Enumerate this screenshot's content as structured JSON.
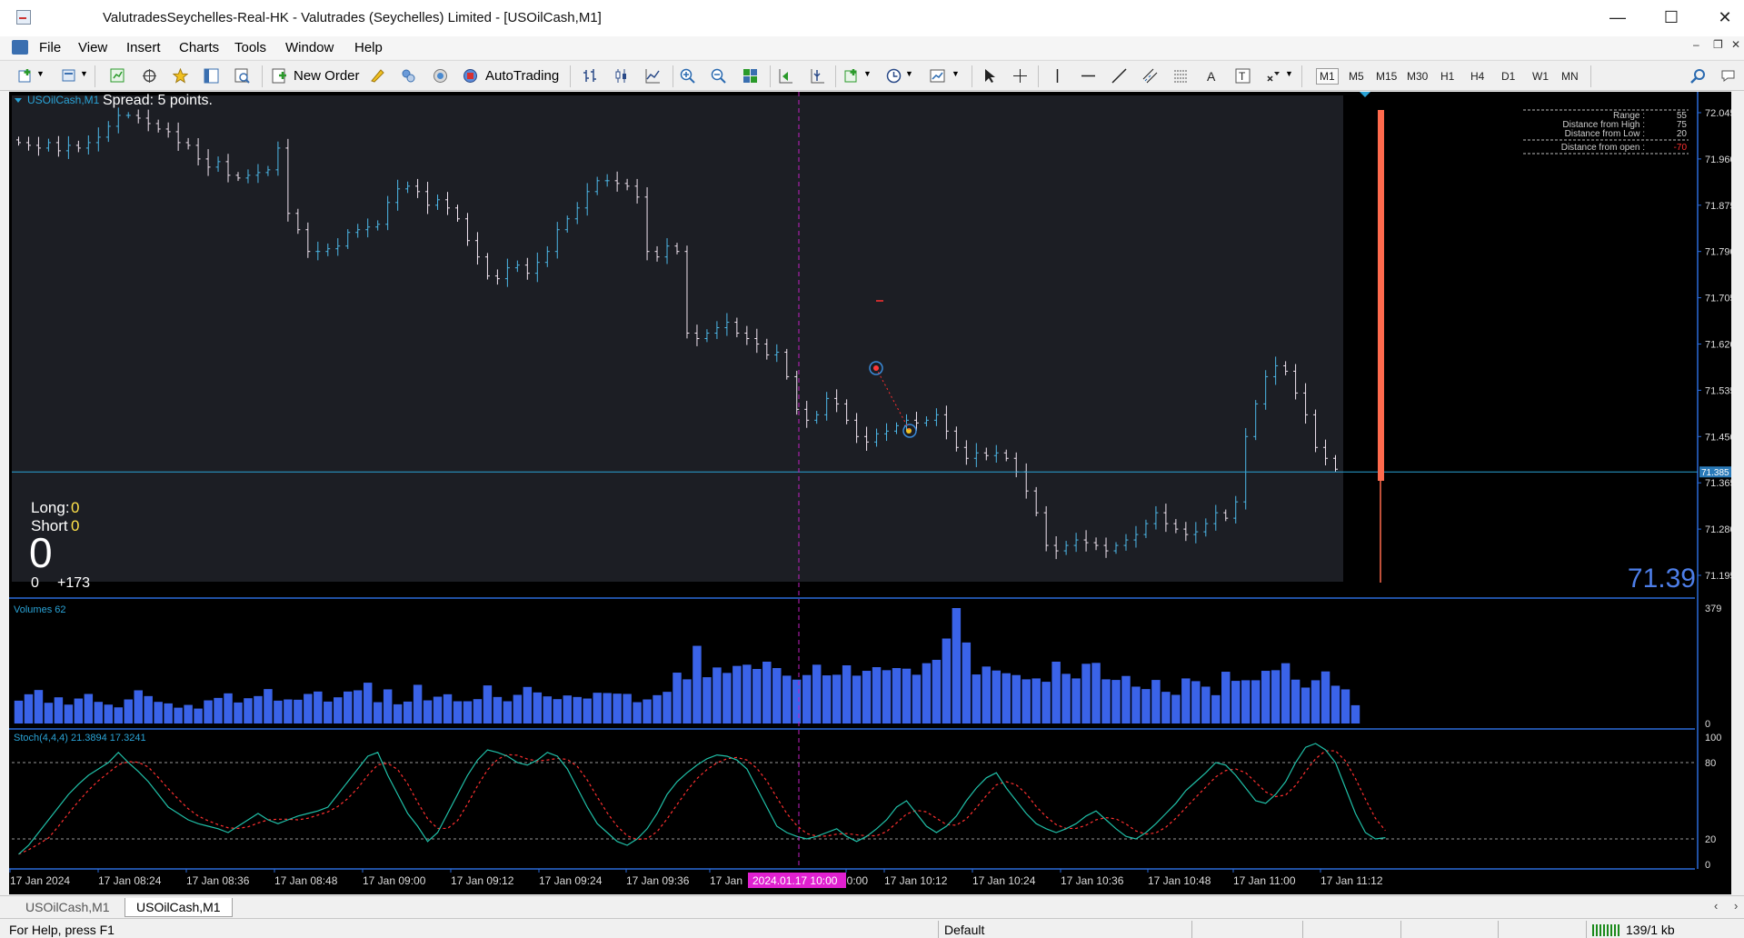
{
  "window": {
    "title": "ValutradesSeychelles-Real-HK - Valutrades (Seychelles) Limited - [USOilCash,M1]",
    "minimize_icon": "minimize-icon",
    "maximize_icon": "maximize-icon",
    "close_icon": "close-icon"
  },
  "menu": {
    "items": [
      "File",
      "View",
      "Insert",
      "Charts",
      "Tools",
      "Window",
      "Help"
    ]
  },
  "toolbar": {
    "new_order_label": "New Order",
    "autotrading_label": "AutoTrading",
    "timeframes": [
      "M1",
      "M5",
      "M15",
      "M30",
      "H1",
      "H4",
      "D1",
      "W1",
      "MN"
    ],
    "active_timeframe": "M1"
  },
  "chart": {
    "symbol_label": "USOilCash,M1",
    "spread_text": "Spread: 5 points.",
    "long_label": "Long:",
    "long_value": "0",
    "short_label": "Short",
    "short_value": "0",
    "big_value": "0",
    "bottom_left_a": "0",
    "bottom_left_b": "+173",
    "current_price_tag": "71.385",
    "current_price_big": "71.39",
    "info_panel": [
      {
        "label": "Range :",
        "value": "55"
      },
      {
        "label": "Distance from High :",
        "value": "75"
      },
      {
        "label": "Distance from Low :",
        "value": "20"
      },
      {
        "label": "Distance from open :",
        "value": "-70"
      }
    ],
    "colors": {
      "background": "#000000",
      "plot_bg": "#1c1e24",
      "bull_candle": "#4db8e8",
      "bear_candle": "#f1e4f0",
      "price_line": "#2aa3d6",
      "price_tag": "#2a7ab8",
      "big_price": "#4d7ee8",
      "red_bar": "#ff6a4d",
      "vline": "#c020c0",
      "volume": "#3a63e8",
      "stoch_main": "#20c0a8",
      "stoch_signal": "#ff3030",
      "axis_text": "#dcdcdc",
      "long_value": "#ffe24a"
    },
    "volumes_label": "Volumes 62",
    "stoch_label": "Stoch(4,4,4) 21.3894 17.3241",
    "crosshair_time_label": "2024.01.17 10:00"
  },
  "chart_data": [
    {
      "type": "candlestick",
      "series": [
        {
          "name": "USOilCash,M1"
        }
      ],
      "x": [
        "17 Jan 2024",
        "17 Jan 08:24",
        "17 Jan 08:36",
        "17 Jan 08:48",
        "17 Jan 09:00",
        "17 Jan 09:12",
        "17 Jan 09:24",
        "17 Jan 09:36",
        "17 Jan",
        "10:00",
        "17 Jan 10:12",
        "17 Jan 10:24",
        "17 Jan 10:36",
        "17 Jan 10:48",
        "17 Jan 11:00",
        "17 Jan 11:12"
      ],
      "yticks": [
        "72.045",
        "71.960",
        "71.875",
        "71.790",
        "71.705",
        "71.620",
        "71.535",
        "71.450",
        "71.365",
        "71.280",
        "71.195"
      ],
      "ylim": [
        71.19,
        72.07
      ],
      "closes": [
        71.99,
        71.985,
        71.98,
        71.99,
        71.975,
        71.985,
        71.98,
        71.99,
        72.0,
        72.02,
        72.04,
        72.04,
        72.035,
        72.025,
        72.015,
        72.01,
        71.99,
        71.985,
        71.96,
        71.945,
        71.955,
        71.93,
        71.925,
        71.93,
        71.935,
        71.94,
        71.98,
        71.86,
        71.83,
        71.79,
        71.79,
        71.795,
        71.8,
        71.825,
        71.83,
        71.835,
        71.84,
        71.88,
        71.905,
        71.91,
        71.9,
        71.875,
        71.885,
        71.87,
        71.85,
        71.81,
        71.78,
        71.745,
        71.74,
        71.76,
        71.765,
        71.75,
        71.77,
        71.79,
        71.83,
        71.85,
        71.87,
        71.9,
        71.92,
        71.92,
        71.915,
        71.91,
        71.89,
        71.79,
        71.78,
        71.8,
        71.79,
        71.64,
        71.63,
        71.64,
        71.65,
        71.66,
        71.64,
        71.63,
        71.62,
        71.6,
        71.605,
        71.56,
        71.5,
        71.48,
        71.49,
        71.52,
        71.51,
        71.48,
        71.45,
        71.44,
        71.455,
        71.46,
        71.47,
        71.48,
        71.475,
        71.48,
        71.49,
        71.46,
        71.43,
        71.41,
        71.42,
        71.415,
        71.42,
        71.41,
        71.385,
        71.35,
        71.31,
        71.25,
        71.24,
        71.25,
        71.26,
        71.255,
        71.25,
        71.24,
        71.25,
        71.26,
        71.27,
        71.29,
        71.31,
        71.29,
        71.28,
        71.27,
        71.275,
        71.29,
        71.31,
        71.3,
        71.33,
        71.45,
        71.51,
        71.56,
        71.58,
        71.57,
        71.53,
        71.49,
        71.43,
        71.41,
        71.39
      ]
    },
    {
      "type": "bar",
      "series": [
        {
          "name": "Volumes 62"
        }
      ],
      "yticks": [
        "379",
        "0"
      ],
      "ylim": [
        0,
        379
      ],
      "values": [
        75,
        96,
        110,
        68,
        86,
        62,
        82,
        97,
        71,
        62,
        53,
        79,
        109,
        90,
        71,
        66,
        52,
        61,
        49,
        76,
        84,
        99,
        69,
        83,
        90,
        113,
        75,
        79,
        78,
        97,
        105,
        72,
        86,
        105,
        109,
        134,
        70,
        112,
        63,
        72,
        127,
        76,
        88,
        96,
        73,
        73,
        80,
        125,
        87,
        73,
        94,
        120,
        102,
        89,
        80,
        92,
        87,
        82,
        101,
        100,
        98,
        97,
        70,
        79,
        93,
        104,
        167,
        145,
        255,
        152,
        184,
        166,
        189,
        193,
        179,
        203,
        182,
        157,
        144,
        159,
        193,
        158,
        160,
        191,
        157,
        173,
        185,
        175,
        182,
        180,
        160,
        198,
        209,
        279,
        379,
        266,
        161,
        187,
        174,
        165,
        159,
        145,
        148,
        137,
        203,
        163,
        148,
        196,
        199,
        145,
        143,
        156,
        121,
        113,
        143,
        104,
        94,
        148,
        139,
        121,
        93,
        170,
        140,
        142,
        142,
        173,
        175,
        198,
        144,
        118,
        142,
        171,
        124,
        112,
        60
      ]
    },
    {
      "type": "line",
      "series": [
        {
          "name": "Stoch(4,4,4) 21.3894 17.3241"
        }
      ],
      "yticks": [
        "100",
        "80",
        "20",
        "0"
      ],
      "ylim": [
        0,
        100
      ],
      "levels": [
        80,
        20
      ],
      "main": [
        8,
        15,
        25,
        35,
        45,
        55,
        63,
        70,
        75,
        80,
        88,
        80,
        73,
        65,
        55,
        45,
        40,
        35,
        32,
        30,
        28,
        25,
        30,
        35,
        40,
        35,
        32,
        35,
        38,
        40,
        42,
        45,
        55,
        65,
        75,
        85,
        88,
        70,
        55,
        40,
        30,
        18,
        25,
        40,
        55,
        70,
        82,
        90,
        88,
        85,
        80,
        78,
        82,
        88,
        85,
        75,
        60,
        45,
        32,
        25,
        18,
        15,
        20,
        28,
        40,
        55,
        65,
        72,
        78,
        83,
        86,
        85,
        82,
        75,
        60,
        45,
        30,
        25,
        22,
        20,
        22,
        25,
        28,
        22,
        18,
        22,
        28,
        35,
        45,
        50,
        40,
        30,
        25,
        30,
        38,
        50,
        60,
        68,
        72,
        60,
        50,
        40,
        32,
        28,
        25,
        28,
        32,
        38,
        42,
        35,
        28,
        22,
        20,
        25,
        32,
        40,
        48,
        58,
        65,
        72,
        80,
        78,
        70,
        60,
        50,
        48,
        55,
        65,
        80,
        92,
        95,
        90,
        80,
        60,
        40,
        25,
        20,
        21
      ]
    }
  ],
  "tabs": {
    "items": [
      "USOilCash,M1",
      "USOilCash,M1"
    ],
    "active_index": 1
  },
  "status": {
    "help_text": "For Help, press F1",
    "profile": "Default",
    "traffic": "139/1 kb"
  }
}
